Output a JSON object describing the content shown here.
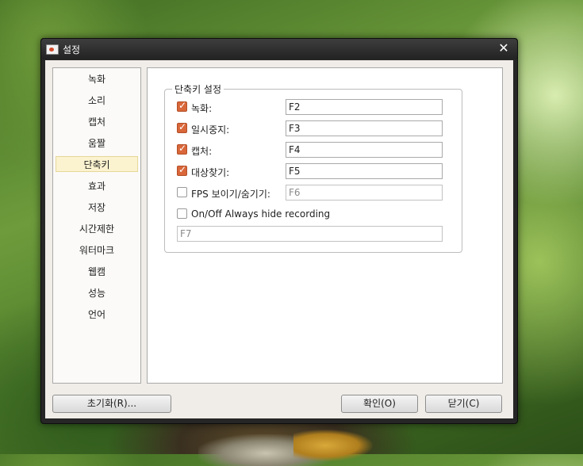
{
  "window": {
    "title": "설정"
  },
  "sidebar": {
    "items": [
      {
        "label": "녹화"
      },
      {
        "label": "소리"
      },
      {
        "label": "캡처"
      },
      {
        "label": "움짤"
      },
      {
        "label": "단축키",
        "selected": true
      },
      {
        "label": "효과"
      },
      {
        "label": "저장"
      },
      {
        "label": "시간제한"
      },
      {
        "label": "워터마크"
      },
      {
        "label": "웹캠"
      },
      {
        "label": "성능"
      },
      {
        "label": "언어"
      }
    ]
  },
  "hotkeys": {
    "group_title": "단축키 설정",
    "rows": [
      {
        "label": "녹화:",
        "checked": true,
        "value": "F2"
      },
      {
        "label": "일시중지:",
        "checked": true,
        "value": "F3"
      },
      {
        "label": "캡처:",
        "checked": true,
        "value": "F4"
      },
      {
        "label": "대상찾기:",
        "checked": true,
        "value": "F5"
      },
      {
        "label": "FPS 보이기/숨기기:",
        "checked": false,
        "value": "F6"
      }
    ],
    "always_hide": {
      "label": "On/Off Always hide recording",
      "checked": false,
      "value": "F7"
    }
  },
  "buttons": {
    "reset": "초기화(R)...",
    "ok": "확인(O)",
    "close": "닫기(C)"
  },
  "accent_color": "#d9673a",
  "icons": {
    "close": "close-icon",
    "app": "app-icon"
  }
}
